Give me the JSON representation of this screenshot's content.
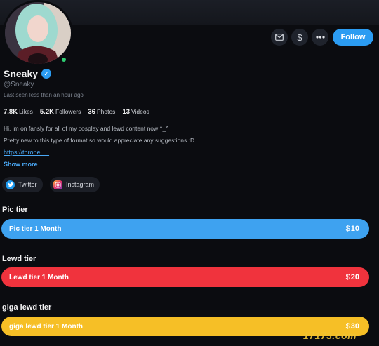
{
  "profile": {
    "name": "Sneaky",
    "handle": "@Sneaky",
    "last_seen": "Last seen less than an hour ago",
    "verified": true,
    "online": true
  },
  "actions": {
    "message_icon": "envelope-icon",
    "tip_icon": "dollar-icon",
    "more_icon": "ellipsis-icon",
    "follow_label": "Follow"
  },
  "stats": [
    {
      "value": "7.8K",
      "label": "Likes"
    },
    {
      "value": "5.2K",
      "label": "Followers"
    },
    {
      "value": "36",
      "label": "Photos"
    },
    {
      "value": "13",
      "label": "Videos"
    }
  ],
  "bio": {
    "line1": "Hi, im on fansly for all of my cosplay and lewd content now ^_^",
    "line2": "Pretty new to this type of format so would appreciate any suggestions :D",
    "link": "https://throne.....",
    "show_more": "Show more"
  },
  "socials": [
    {
      "label": "Twitter",
      "icon": "twitter-icon",
      "color": "#1d9bf0"
    },
    {
      "label": "Instagram",
      "icon": "instagram-icon",
      "color": "#d6336c"
    }
  ],
  "tiers": [
    {
      "title": "Pic tier",
      "button": "Pic tier 1 Month",
      "price": "10",
      "color": "#3ea2f0"
    },
    {
      "title": "Lewd tier",
      "button": "Lewd tier 1 Month",
      "price": "20",
      "color": "#f0333d"
    },
    {
      "title": "giga lewd tier",
      "button": "giga lewd tier 1 Month",
      "price": "30",
      "color": "#f6bf26"
    }
  ],
  "currency_symbol": "$",
  "watermark": "17173.com"
}
